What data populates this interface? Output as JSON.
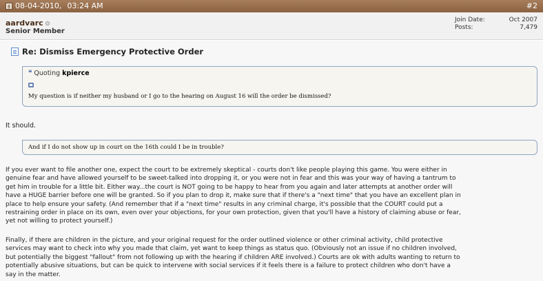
{
  "header": {
    "date": "08-04-2010,",
    "time": "03:24 AM",
    "post_number": "#2",
    "bg_color": "#8b6241"
  },
  "user": {
    "username": "aardvarc",
    "title": "Senior Member",
    "stats": [
      {
        "label": "Join Date:",
        "value": "Oct 2007"
      },
      {
        "label": "Posts:",
        "value": "7,479"
      }
    ]
  },
  "post": {
    "title": "Re: Dismiss Emergency Protective Order",
    "quote1": {
      "prefix": "Quoting",
      "author": "kpierce",
      "text": "My question is if neither my husband or I go to the hearing on August 16 will the order be dismissed?"
    },
    "reply1": "It should.",
    "quote2": {
      "text": "And if I do not show up in court on the 16th could I be in trouble?"
    },
    "paragraph1_lines": [
      "If you ever want to file another one, expect the court to be extremely skeptical - courts don't like people playing this game. You were either in",
      "genuine fear and have allowed yourself to be sweet-talked into dropping it, or you were not in fear and this was your way of having a tantrum to",
      "get him in trouble for a little bit. Either way...the court is NOT going to be happy to hear from you again and later attempts at another order will",
      "have a HUGE barrier before one will be granted. So if you plan to drop it, make sure that if there's a \"next time\" that you have an excellent plan in",
      "place to help ensure your safety. (And remember that if a \"next time\" results in any criminal charge, it's possible that the COURT could put a",
      "restraining order in place on its own, even over your objections, for your own protection, given that you'll have a history of claiming abuse or fear,",
      "yet not willing to protect yourself.)"
    ],
    "paragraph2_lines": [
      "Finally, if there are children in the picture, and your original request for the order outlined violence or other criminal activity, child protective",
      "services may want to check into why you made that claim, yet want to keep things as status quo. (Obviously not an issue if no children involved,",
      "but potentially the biggest \"fallout\" from not following up with the hearing if children ARE involved.) Courts are ok with adults wanting to return to",
      "potentially abusive situations, but can be quick to intervene with social services if it feels there is a failure to protect children who don't have a",
      "say in the matter."
    ]
  }
}
